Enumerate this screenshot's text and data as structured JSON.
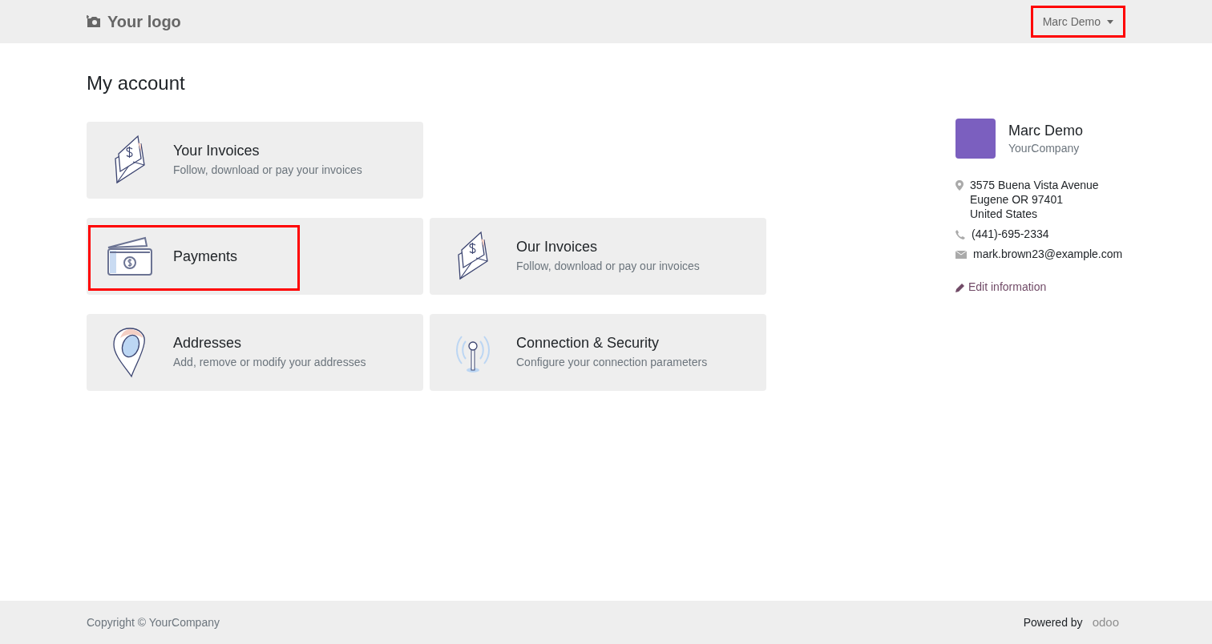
{
  "header": {
    "logo": "Your logo",
    "user_menu": {
      "label": "Marc Demo",
      "highlighted": true
    }
  },
  "page_title": "My account",
  "card_rows": [
    [
      {
        "kind": "invoice",
        "title": "Your Invoices",
        "description": "Follow, download or pay your invoices",
        "highlighted": false
      }
    ],
    [
      {
        "kind": "payment",
        "title": "Payments",
        "highlighted": true
      },
      {
        "kind": "invoice",
        "title": "Our Invoices",
        "description": "Follow, download or pay our invoices",
        "highlighted": false
      }
    ],
    [
      {
        "kind": "address",
        "title": "Addresses",
        "description": "Add, remove or modify your addresses",
        "highlighted": false
      },
      {
        "kind": "security",
        "title": "Connection & Security",
        "description": "Configure your connection parameters",
        "highlighted": false
      }
    ]
  ],
  "profile": {
    "name": "Marc Demo",
    "company": "YourCompany",
    "address_lines": [
      "3575 Buena Vista Avenue",
      "Eugene OR 97401",
      "United States"
    ],
    "phone": "(441)-695-2334",
    "email": "mark.brown23@example.com",
    "edit_link": "Edit information"
  },
  "footer": {
    "copyright": "Copyright © YourCompany",
    "powered_by": "Powered by",
    "brand": "odoo"
  }
}
